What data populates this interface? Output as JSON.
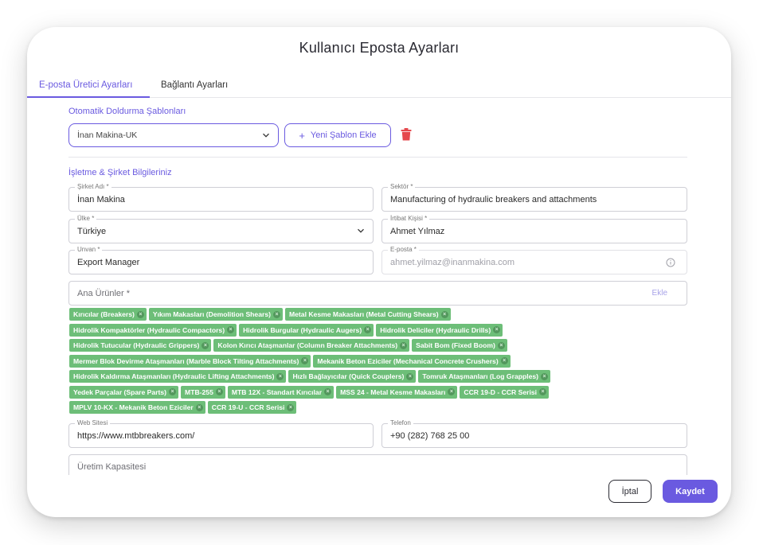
{
  "dialog": {
    "title": "Kullanıcı Eposta Ayarları"
  },
  "tabs": [
    {
      "label": "E-posta Üretici Ayarları",
      "active": true
    },
    {
      "label": "Bağlantı Ayarları",
      "active": false
    }
  ],
  "templates": {
    "section_title": "Otomatik Doldurma Şablonları",
    "selected": "İnan Makina-UK",
    "add_button": "Yeni Şablon Ekle",
    "add_icon": "+"
  },
  "company": {
    "section_title": "İşletme & Şirket Bilgileriniz",
    "company_name": {
      "label": "Şirket Adı *",
      "value": "İnan Makina"
    },
    "sector": {
      "label": "Sektör *",
      "value": "Manufacturing of hydraulic breakers and attachments"
    },
    "country": {
      "label": "Ülke *",
      "value": "Türkiye"
    },
    "contact": {
      "label": "İrtibat Kişisi *",
      "value": "Ahmet Yılmaz"
    },
    "title": {
      "label": "Unvan *",
      "value": "Export Manager"
    },
    "email": {
      "label": "E-posta *",
      "value": "ahmet.yilmaz@inanmakina.com"
    },
    "products": {
      "placeholder": "Ana Ürünler *",
      "add_label": "Ekle"
    },
    "product_tags": [
      [
        "Kırıcılar (Breakers)",
        "Yıkım Makasları (Demolition Shears)",
        "Metal Kesme Makasları (Metal Cutting Shears)"
      ],
      [
        "Hidrolik Kompaktörler (Hydraulic Compactors)",
        "Hidrolik Burgular (Hydraulic Augers)",
        "Hidrolik Deliciler (Hydraulic Drills)"
      ],
      [
        "Hidrolik Tutucular (Hydraulic Grippers)",
        "Kolon Kırıcı Ataşmanlar (Column Breaker Attachments)",
        "Sabit Bom (Fixed Boom)"
      ],
      [
        "Mermer Blok Devirme Ataşmanları (Marble Block Tilting Attachments)",
        "Mekanik Beton Eziciler (Mechanical Concrete Crushers)"
      ],
      [
        "Hidrolik Kaldırma Ataşmanları (Hydraulic Lifting Attachments)",
        "Hızlı Bağlayıcılar (Quick Couplers)",
        "Tomruk Ataşmanları (Log Grapples)"
      ],
      [
        "Yedek Parçalar (Spare Parts)",
        "MTB-255",
        "MTB 12X - Standart Kırıcılar",
        "MSS 24 - Metal Kesme Makasları",
        "CCR 19-D - CCR Serisi"
      ],
      [
        "MPLV 10-KX - Mekanik Beton Eziciler",
        "CCR 19-U - CCR Serisi"
      ]
    ],
    "website": {
      "label": "Web Sitesi",
      "value": "https://www.mtbbreakers.com/"
    },
    "phone": {
      "label": "Telefon",
      "value": "+90 (282) 768 25 00"
    },
    "capacity": {
      "placeholder": "Üretim Kapasitesi"
    }
  },
  "actions": {
    "cancel": "İptal",
    "save": "Kaydet"
  },
  "colors": {
    "accent": "#6a5ae0",
    "tag": "#6dbe78",
    "danger": "#e5484d"
  }
}
